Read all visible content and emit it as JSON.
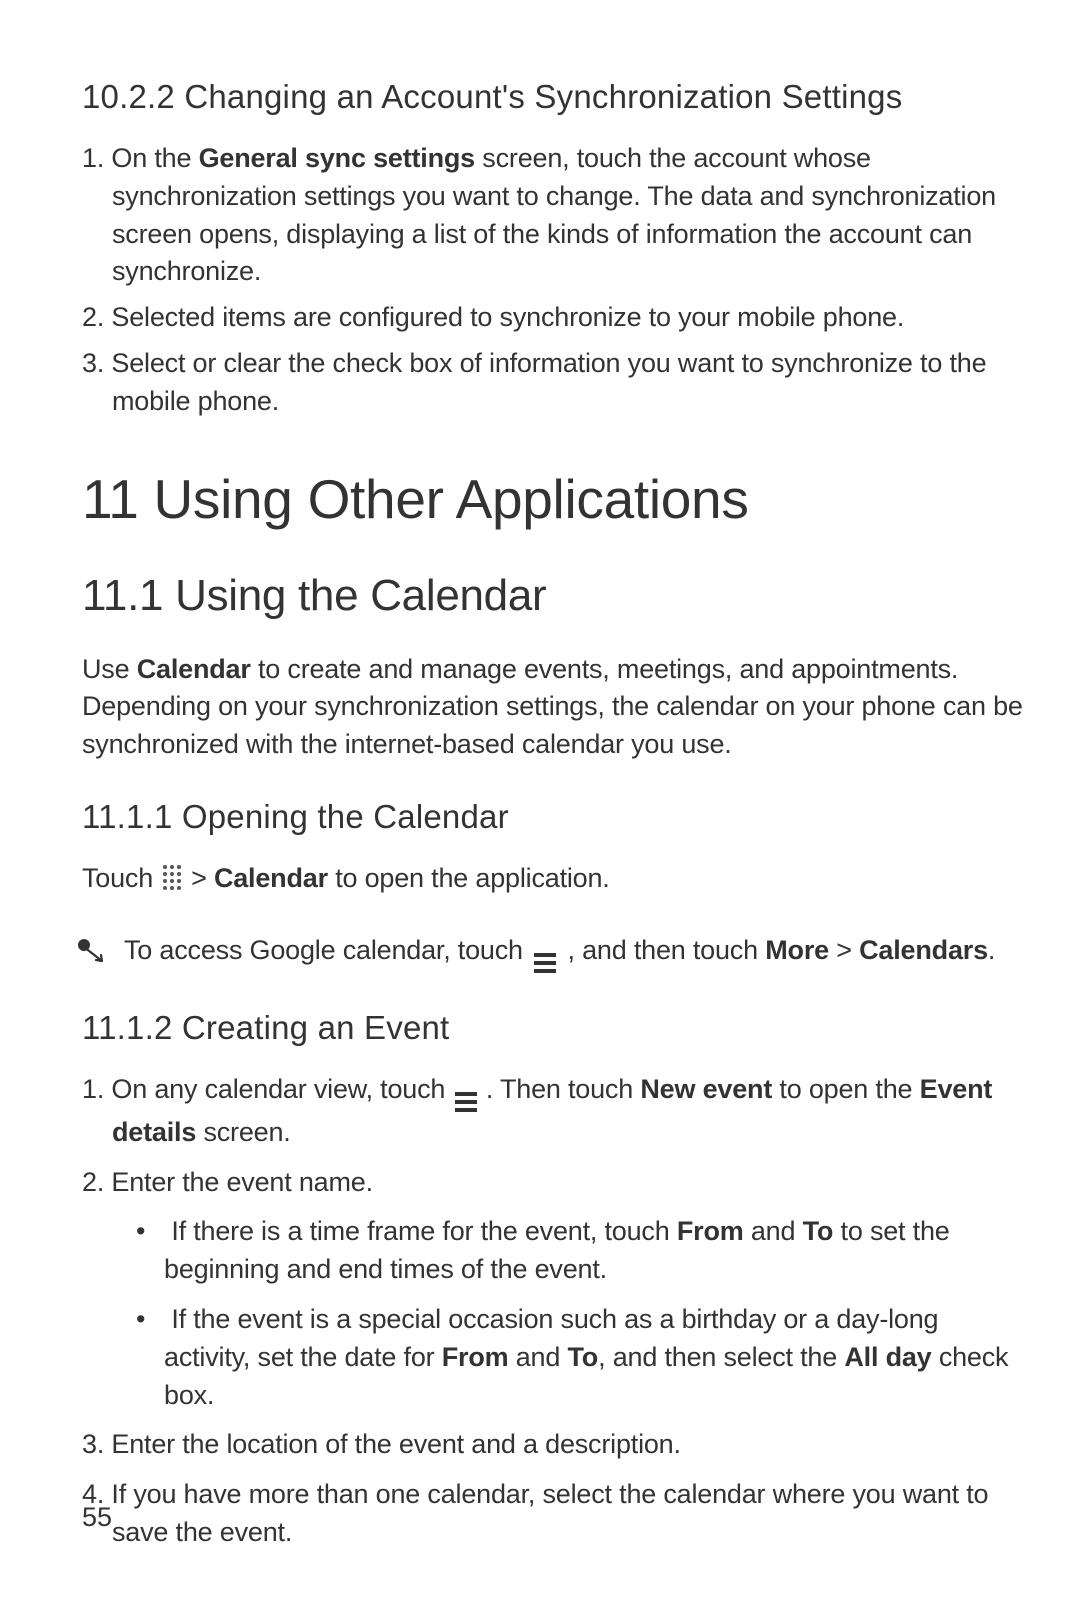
{
  "section_10_2_2": {
    "heading": "10.2.2  Changing an Account's Synchronization Settings",
    "item1_pre": "1. On the ",
    "item1_bold": "General sync settings",
    "item1_post": " screen, touch the account whose synchronization settings you want to change. The data and synchronization screen opens, displaying a list of the kinds of information the account can synchronize.",
    "item2": "2. Selected items are configured to synchronize to your mobile phone.",
    "item3": "3. Select or clear the check box of information you want to synchronize to the mobile phone."
  },
  "section_11": {
    "heading": "11  Using Other Applications"
  },
  "section_11_1": {
    "heading": "11.1  Using the Calendar",
    "para_pre": "Use ",
    "para_bold": "Calendar",
    "para_post": " to create and manage events, meetings, and appointments. Depending on your synchronization settings, the calendar on your phone can be synchronized with the internet-based calendar you use."
  },
  "section_11_1_1": {
    "heading": "11.1.1  Opening the Calendar",
    "line_pre": "Touch  ",
    "line_mid": "  > ",
    "line_bold": "Calendar",
    "line_post": " to open the application.",
    "note_pre": "To access Google calendar,  touch  ",
    "note_mid": " ,  and then touch ",
    "note_bold1": "More",
    "note_sep": " > ",
    "note_bold2": "Calendars",
    "note_end": "."
  },
  "section_11_1_2": {
    "heading": "11.1.2  Creating an Event",
    "item1_pre": "1. On any calendar view, touch  ",
    "item1_mid": " . Then touch ",
    "item1_bold1": "New event",
    "item1_mid2": " to open the ",
    "item1_bold2": "Event details",
    "item1_post": " screen.",
    "item2": "2. Enter the event name.",
    "sub1_pre": "If there is a time frame for the event, touch ",
    "sub1_bold1": "From",
    "sub1_mid": " and ",
    "sub1_bold2": "To",
    "sub1_post": " to set the beginning and end times of the event.",
    "sub2_pre": "If the event is a special occasion such as a birthday or a day-long activity, set the date for ",
    "sub2_bold1": "From",
    "sub2_mid1": " and ",
    "sub2_bold2": "To",
    "sub2_mid2": ", and then select the ",
    "sub2_bold3": "All day",
    "sub2_post": " check box.",
    "item3": "3. Enter the location of the event and a description.",
    "item4": "4. If you have more than one calendar, select the calendar where you want to save the event."
  },
  "page_number": "55"
}
